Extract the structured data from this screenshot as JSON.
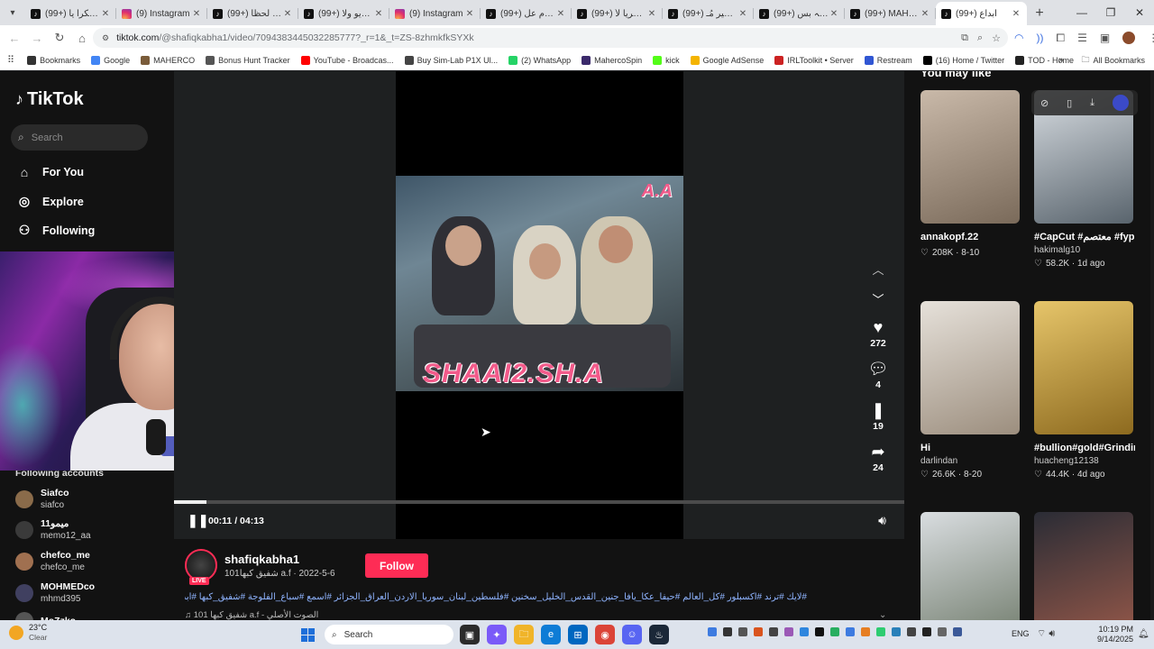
{
  "browser": {
    "tabs": [
      {
        "icon": "tiktok-icon",
        "label": "(99+) شكراً يا ..."
      },
      {
        "icon": "instagram-icon",
        "label": "(9) Instagram"
      },
      {
        "icon": "tiktok-icon",
        "label": "(99+) أبرز لحظا..."
      },
      {
        "icon": "tiktok-icon",
        "label": "(99+) فيديو ولا..."
      },
      {
        "icon": "instagram-icon",
        "label": "(9) Instagram"
      },
      {
        "icon": "tiktok-icon",
        "label": "(99+) السلام عل..."
      },
      {
        "icon": "tiktok-icon",
        "label": "(99+) حصريا لأ..."
      },
      {
        "icon": "tiktok-icon",
        "label": "(99+) الفقير مُـ..."
      },
      {
        "icon": "tiktok-icon",
        "label": "(99+) واللہ بس..."
      },
      {
        "icon": "tiktok-icon",
        "label": "(99+) MAHERCO"
      },
      {
        "icon": "tiktok-icon",
        "label": "(99+) ابداع"
      }
    ],
    "url_domain": "tiktok.com",
    "url_path": "/@shafiqkabha1/video/7094383445032285777?_r=1&_t=ZS-8zhmkfkSYXk",
    "bookmarks": [
      {
        "label": "Bookmarks",
        "icon": "star-icon",
        "color": "#333333"
      },
      {
        "label": "Google",
        "icon": "google-icon",
        "color": "#4285f4"
      },
      {
        "label": "MAHERCO",
        "icon": "maherco-icon",
        "color": "#7a5c3a"
      },
      {
        "label": "Bonus Hunt Tracker",
        "icon": "gear-icon",
        "color": "#555555"
      },
      {
        "label": "YouTube - Broadcas...",
        "icon": "youtube-icon",
        "color": "#ff0000"
      },
      {
        "label": "Buy Sim-Lab P1X Ul...",
        "icon": "simlab-icon",
        "color": "#444444"
      },
      {
        "label": "(2) WhatsApp",
        "icon": "whatsapp-icon",
        "color": "#25d366"
      },
      {
        "label": "MahercoSpin",
        "icon": "maherco-spin-icon",
        "color": "#3b2a6b"
      },
      {
        "label": "kick",
        "icon": "kick-icon",
        "color": "#53fc18"
      },
      {
        "label": "Google AdSense",
        "icon": "adsense-icon",
        "color": "#f4b400"
      },
      {
        "label": "IRLToolkit • Server",
        "icon": "irltoolkit-icon",
        "color": "#cc2222"
      },
      {
        "label": "Restream",
        "icon": "restream-icon",
        "color": "#3056d3"
      },
      {
        "label": "(16) Home / Twitter",
        "icon": "x-icon",
        "color": "#000000"
      },
      {
        "label": "TOD - Home",
        "icon": "tod-icon",
        "color": "#222222"
      }
    ],
    "all_bookmarks": "All Bookmarks"
  },
  "tiktok": {
    "logo": "TikTok",
    "search_placeholder": "Search",
    "nav": [
      {
        "label": "For You",
        "icon": "home-icon"
      },
      {
        "label": "Explore",
        "icon": "compass-icon"
      },
      {
        "label": "Following",
        "icon": "following-icon"
      }
    ],
    "following_title": "Following accounts",
    "following": [
      {
        "name": "Siafco",
        "handle": "siafco",
        "color": "#8a6b4a"
      },
      {
        "name": "ميمو11",
        "handle": "memo12_aa",
        "color": "#3a3a3a"
      },
      {
        "name": "chefco_me",
        "handle": "chefco_me",
        "color": "#a07050"
      },
      {
        "name": "MOHMEDco",
        "handle": "mhmd395",
        "color": "#404060"
      },
      {
        "name": "MoZzko",
        "handle": "",
        "color": "#555555"
      }
    ],
    "video": {
      "watermark_top": "A.A",
      "watermark_bottom": "SHAAI2.SH.A",
      "time": "00:11 / 04:13",
      "progress": 0.045,
      "likes": "272",
      "comments": "4",
      "saves": "19",
      "shares": "24"
    },
    "author": {
      "handle": "shafiqkabha1",
      "sub": "101شفيق كبها a.f · 2022-5-6",
      "live": "LIVE",
      "follow_label": "Follow"
    },
    "caption": "#لايك #ترند #اكسبلور #كل_العالم #حيفا_عكا_يافا_جنين_القدس_الخليل_سخنين #فلسطين_لبنان_سوريا_الاردن_العراق_الجزائر #اسمع #سباع_الفلوجة #شفيق_كبها #ابداع",
    "sound": "101 شفيق كبها a.f - الصوت الأصلي",
    "you_may_like": "You may like",
    "recommendations": [
      {
        "title": "annakopf.22",
        "user": "",
        "likes": "208K",
        "date": "8-10",
        "colors": [
          "#c9b9a9",
          "#7a6a5a"
        ]
      },
      {
        "title": "#CapCut #معتصم #fyp #tik_to...",
        "user": "hakimalg10",
        "likes": "58.2K",
        "date": "1d ago",
        "colors": [
          "#d8dde2",
          "#59646d"
        ]
      },
      {
        "title": "Hi",
        "user": "darlindan",
        "likes": "26.6K",
        "date": "8-20",
        "colors": [
          "#e6e1da",
          "#9c8e7e"
        ]
      },
      {
        "title": "#bullion#gold#Grinding#mechanical#Al...",
        "user": "huacheng12138",
        "likes": "44.4K",
        "date": "4d ago",
        "colors": [
          "#e6c56a",
          "#8d6a1f"
        ]
      },
      {
        "title": "",
        "user": "",
        "likes": "",
        "date": "",
        "colors": [
          "#d9dde0",
          "#6f7a6a"
        ]
      },
      {
        "title": "",
        "user": "",
        "likes": "",
        "date": "",
        "colors": [
          "#2a2c35",
          "#9a5a4a"
        ]
      }
    ]
  },
  "taskbar": {
    "temp": "23°C",
    "weather": "Clear",
    "search": "Search",
    "lang": "ENG",
    "time": "10:19 PM",
    "date": "9/14/2025"
  }
}
